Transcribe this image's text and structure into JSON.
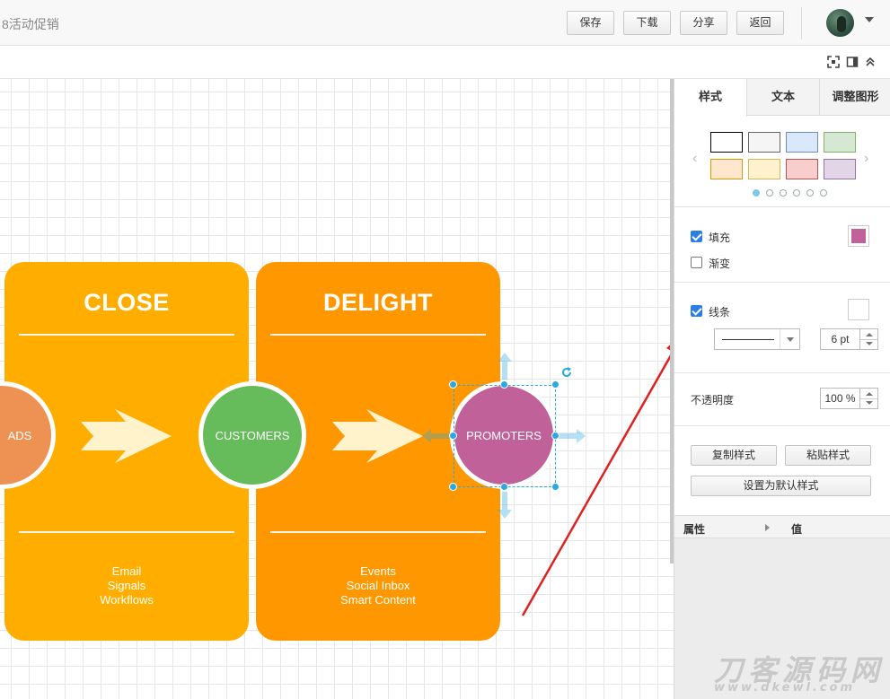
{
  "header": {
    "title": "8活动促销",
    "buttons": {
      "save": "保存",
      "download": "下载",
      "share": "分享",
      "back": "返回"
    }
  },
  "toolbar2": {
    "icons": [
      "fit-screen-icon",
      "panel-toggle-icon",
      "collapse-icon"
    ]
  },
  "canvas": {
    "stages": [
      {
        "title": "CLOSE",
        "color": "#FFAE00",
        "items": [
          "Email",
          "Signals",
          "Workflows"
        ]
      },
      {
        "title": "DELIGHT",
        "color": "#FF9800",
        "items": [
          "Events",
          "Social Inbox",
          "Smart Content"
        ]
      }
    ],
    "nodes": [
      {
        "label": "ADS",
        "color": "#EE9254"
      },
      {
        "label": "CUSTOMERS",
        "color": "#66BB5A"
      },
      {
        "label": "PROMOTERS",
        "color": "#C1619A",
        "selected": true
      }
    ],
    "arrow_color": "#FFF3CC"
  },
  "panel": {
    "tabs": [
      "样式",
      "文本",
      "调整图形"
    ],
    "active_tab": 0,
    "swatches": [
      {
        "fill": "#FFFFFF",
        "stroke": "#000000"
      },
      {
        "fill": "#F5F5F5",
        "stroke": "#666666"
      },
      {
        "fill": "#DAE8FC",
        "stroke": "#6C8EBF"
      },
      {
        "fill": "#D5E8D4",
        "stroke": "#82B366"
      },
      {
        "fill": "#FFE6CC",
        "stroke": "#D79B00"
      },
      {
        "fill": "#FFF2CC",
        "stroke": "#D6B656"
      },
      {
        "fill": "#F8CECC",
        "stroke": "#B85450"
      },
      {
        "fill": "#E1D5E7",
        "stroke": "#9673A6"
      }
    ],
    "pager": {
      "count": 6,
      "active": 0
    },
    "fill": {
      "label": "填充",
      "checked": true,
      "color": "#C1619A"
    },
    "gradient": {
      "label": "渐变",
      "checked": false
    },
    "line": {
      "label": "线条",
      "checked": true,
      "color": "#FFFFFF",
      "width": "6 pt"
    },
    "opacity": {
      "label": "不透明度",
      "value": "100 %"
    },
    "buttons": {
      "copy_style": "复制样式",
      "paste_style": "粘贴样式",
      "set_default": "设置为默认样式"
    },
    "properties": {
      "col1": "属性",
      "col2": "值"
    }
  },
  "watermark": {
    "main": "刀客源码网",
    "sub": "www.dkewl.com"
  }
}
